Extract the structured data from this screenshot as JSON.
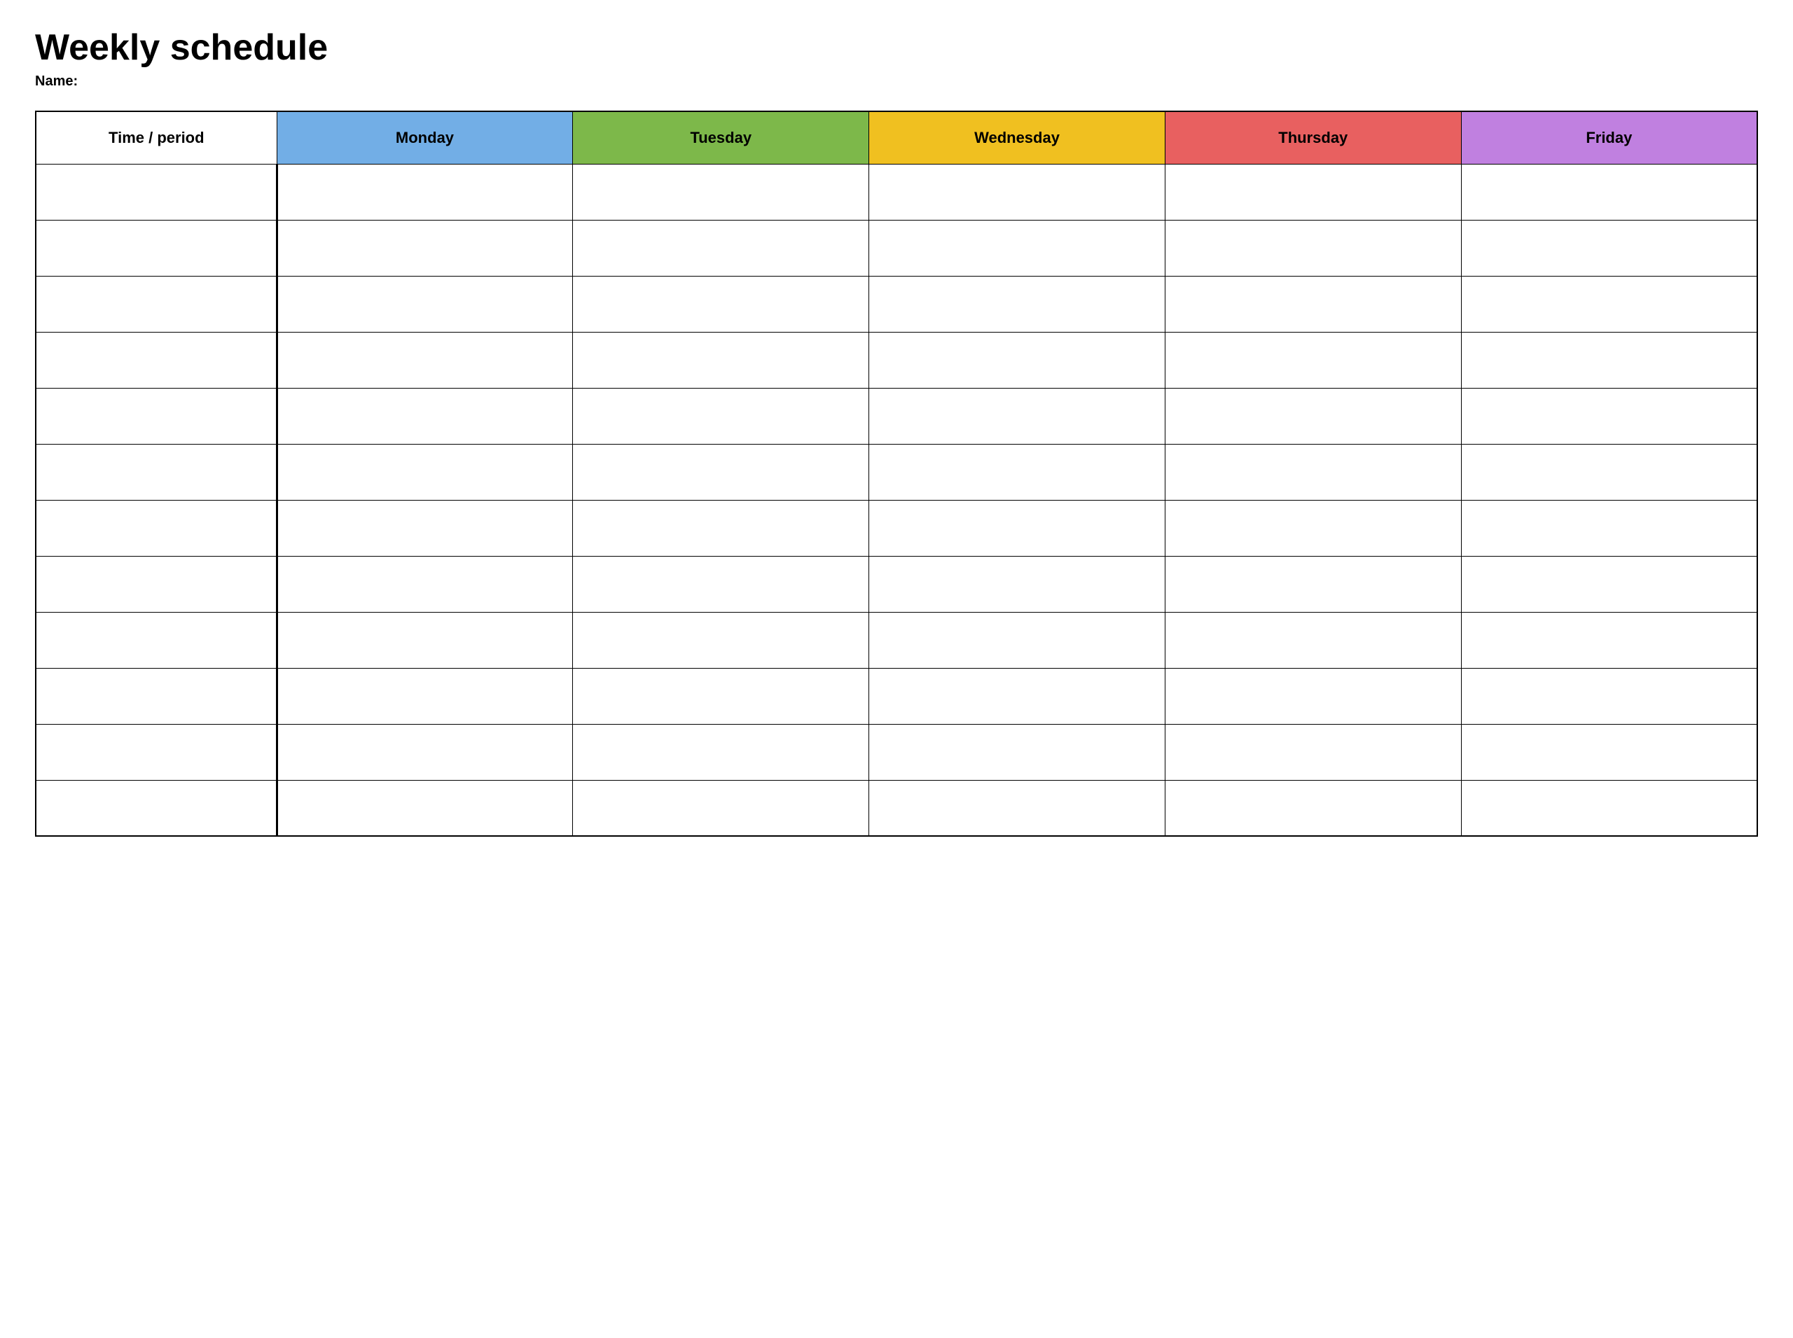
{
  "page": {
    "title": "Weekly schedule",
    "name_label": "Name:",
    "table": {
      "headers": {
        "time_period": "Time / period",
        "monday": "Monday",
        "tuesday": "Tuesday",
        "wednesday": "Wednesday",
        "thursday": "Thursday",
        "friday": "Friday"
      },
      "row_count": 12,
      "colors": {
        "monday": "#72aee6",
        "tuesday": "#7db84a",
        "wednesday": "#f0c020",
        "thursday": "#e86060",
        "friday": "#c080e0"
      }
    }
  }
}
